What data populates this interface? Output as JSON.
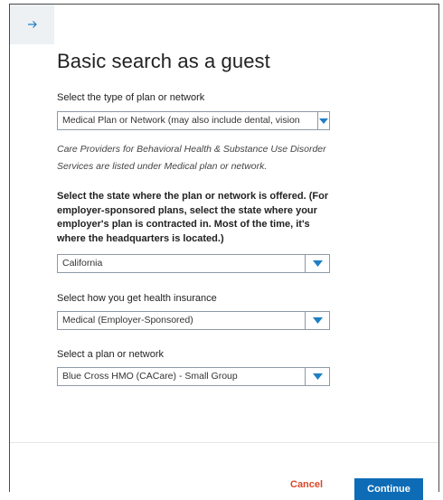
{
  "header": {
    "back_icon": "arrow-right-icon",
    "title": "Basic search as a guest"
  },
  "plan_type": {
    "label": "Select the type of plan or network",
    "value": "Medical Plan or Network (may also include dental, vision"
  },
  "note": "Care Providers for Behavioral Health & Substance Use Disorder Services are listed under Medical plan or network.",
  "state": {
    "label": "Select the state where the plan or network is offered. (For employer-sponsored plans, select the state where your employer's plan is contracted in. Most of the time, it's where the headquarters is located.)",
    "value": "California"
  },
  "insurance_source": {
    "label": "Select how you get health insurance",
    "value": "Medical (Employer-Sponsored)"
  },
  "plan": {
    "label": "Select a plan or network",
    "value": "Blue Cross HMO (CACare) - Small Group"
  },
  "footer": {
    "cancel_label": "Cancel",
    "continue_label": "Continue"
  },
  "colors": {
    "accent": "#0e6cb6",
    "cancel": "#d9472b",
    "arrow": "#1f7fc4"
  }
}
